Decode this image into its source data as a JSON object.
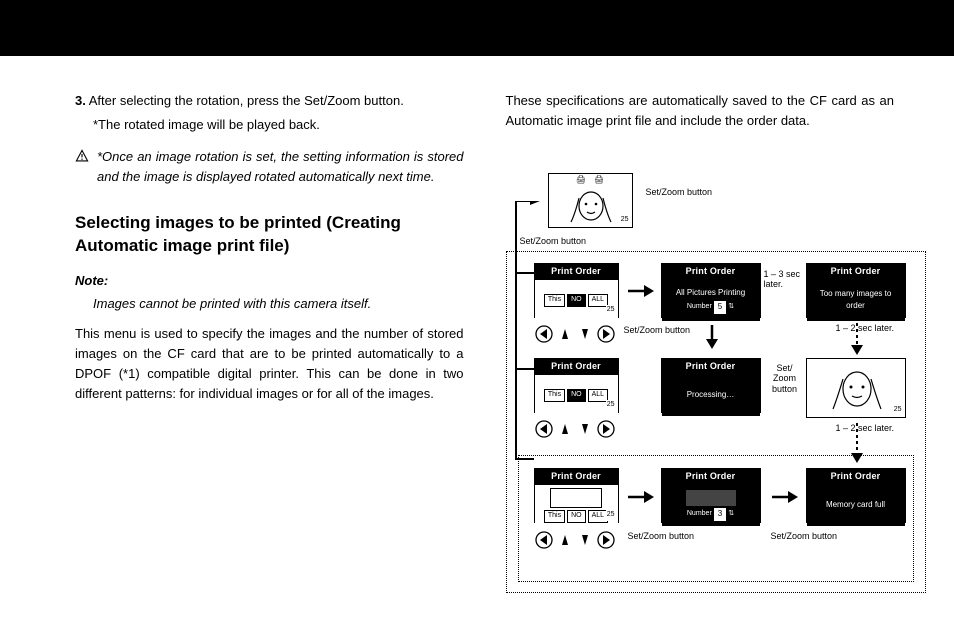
{
  "left": {
    "step_num": "3.",
    "step_text": "After selecting the rotation, press the Set/Zoom button.",
    "step_sub": "*The rotated image will be played back.",
    "warning": "*Once an image rotation is set, the setting information is stored and the image is displayed rotated automatically next time.",
    "section_title": "Selecting images to be printed (Creating Automatic image print file)",
    "note_label": "Note:",
    "note_body": "Images cannot be printed with this camera itself.",
    "body1": "This menu is used to specify the images and the number of stored images on the CF card that are to be printed automatically to a DPOF (*1) compatible digital printer. This can be done in two different patterns: for individual images or for all of the images."
  },
  "right": {
    "intro": "These specifications are automatically saved to the CF card as an Automatic image print file and include the order data.",
    "labels": {
      "setzoom": "Set/Zoom button",
      "setzoom_stack": "Set/\nZoom\nbutton",
      "delay13": "1 – 3 sec later.",
      "delay12": "1 – 2 sec later."
    },
    "screens": {
      "print_order": "Print Order",
      "tabs_this": "This",
      "tabs_no": "NO",
      "tabs_all": "ALL",
      "all_printing": "All Pictures Printing",
      "number_label": "Number",
      "number_val5": "5",
      "number_val3": "3",
      "processing": "Processing…",
      "too_many": "Too many images to order",
      "card_full": "Memory card full",
      "count25": "25"
    }
  }
}
